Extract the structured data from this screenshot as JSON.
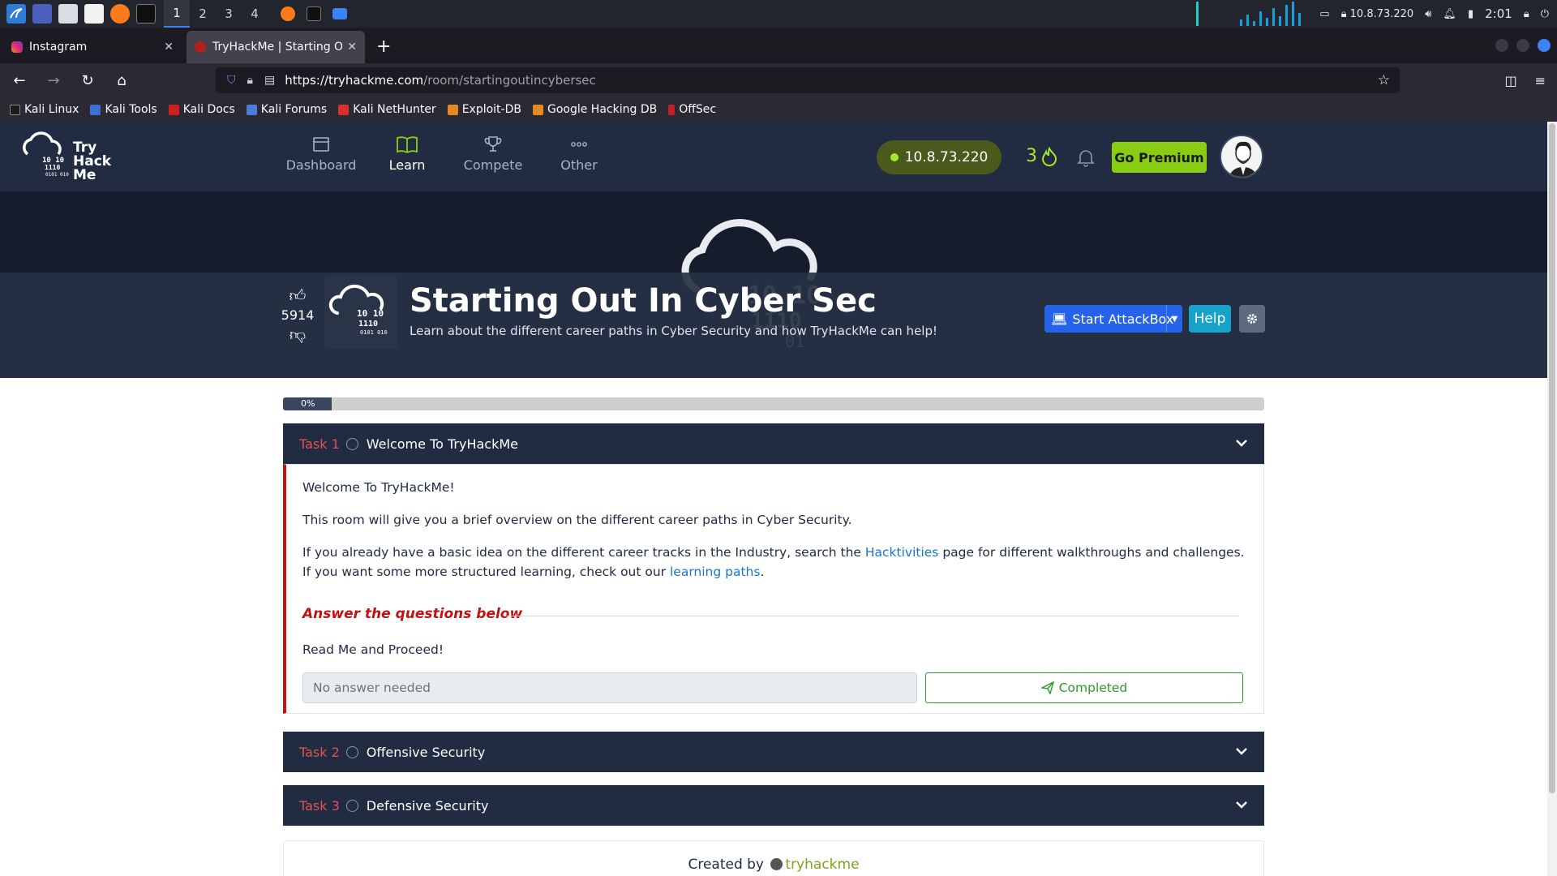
{
  "taskbar": {
    "workspaces": [
      "1",
      "2",
      "3",
      "4"
    ],
    "active_workspace": "1",
    "vpn_ip": "10.8.73.220",
    "clock": "2:01"
  },
  "browser": {
    "tabs": [
      {
        "title": "Instagram",
        "active": false
      },
      {
        "title": "TryHackMe | Starting Out In Cyber Sec",
        "active": true
      }
    ],
    "url_host": "https://tryhackme.com",
    "url_path": "/room/startingoutincybersec",
    "bookmarks": [
      "Kali Linux",
      "Kali Tools",
      "Kali Docs",
      "Kali Forums",
      "Kali NetHunter",
      "Exploit-DB",
      "Google Hacking DB",
      "OffSec"
    ]
  },
  "thm": {
    "logo": {
      "line1": "Try",
      "line2": "Hack",
      "line3": "Me"
    },
    "nav": [
      {
        "label": "Dashboard",
        "active": false,
        "icon": "dashboard-icon"
      },
      {
        "label": "Learn",
        "active": true,
        "icon": "book-icon"
      },
      {
        "label": "Compete",
        "active": false,
        "icon": "trophy-icon"
      },
      {
        "label": "Other",
        "active": false,
        "icon": "more-icon"
      }
    ],
    "ip": "10.8.73.220",
    "streak": "3",
    "premium_label": "Go Premium"
  },
  "room": {
    "votes": "5914",
    "title": "Starting Out In Cyber Sec",
    "description": "Learn about the different career paths in Cyber Security and how TryHackMe can help!",
    "attackbox_label": "Start AttackBox",
    "help_label": "Help",
    "progress_label": "0%",
    "progress_value": 0
  },
  "tasks": [
    {
      "num": "Task 1",
      "title": "Welcome To TryHackMe"
    },
    {
      "num": "Task 2",
      "title": "Offensive Security"
    },
    {
      "num": "Task 3",
      "title": "Defensive Security"
    }
  ],
  "task1_body": {
    "p1": "Welcome To TryHackMe!",
    "p2": "This room will give you a brief overview on the different career paths in Cyber Security.",
    "p3_a": "If you already have a basic idea on the different career tracks in the Industry, search the ",
    "p3_link1": "Hacktivities",
    "p3_b": " page for different walkthroughs and challenges. If you want some more structured learning, check out our ",
    "p3_link2": "learning paths",
    "p3_c": ".",
    "answer_heading": "Answer the questions below",
    "question": "Read Me and Proceed!",
    "answer_placeholder": "No answer needed",
    "completed_label": "Completed"
  },
  "footer": {
    "created_by": "Created by",
    "author": "tryhackme"
  },
  "colors": {
    "thm_navy": "#212c42",
    "thm_green": "#88cc14",
    "task_red": "#c11111",
    "link_blue": "#1a76d2",
    "completed_green": "#2a9d2a"
  }
}
